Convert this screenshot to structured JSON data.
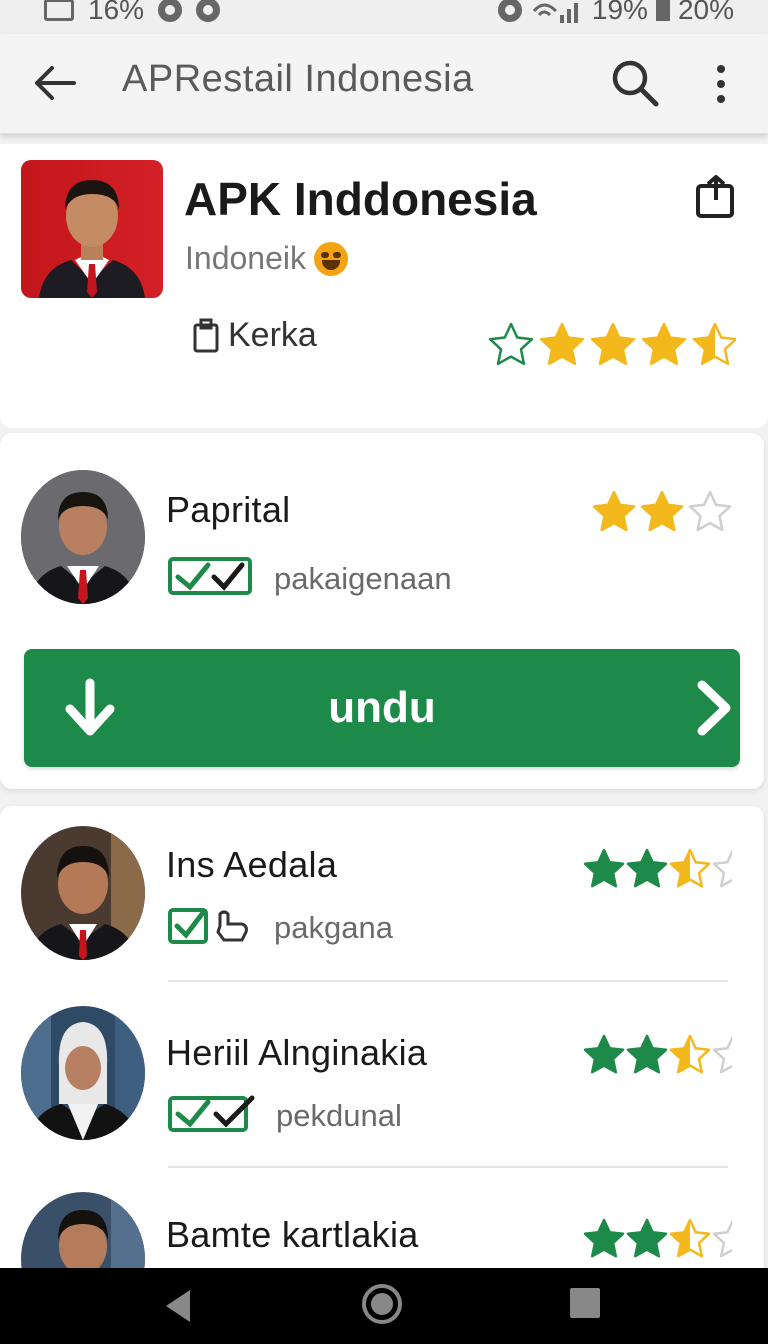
{
  "status_bar": {
    "left_text": "16%",
    "right_signal": "19%",
    "right_battery": "20%"
  },
  "app_bar": {
    "title": "APRestail Indonesia"
  },
  "app_header": {
    "name": "APK Inddonesia",
    "developer": "Indoneik",
    "install_label": "Kerka",
    "rating_stars": 3.5
  },
  "featured": {
    "title": "Paprital",
    "subtitle": "pakaigenaan",
    "rating_stars": 2.0,
    "download_label": "undu"
  },
  "list": [
    {
      "title": "Ins Aedala",
      "subtitle": "pakgana",
      "rating_stars": 2.5,
      "badge": "check-hand"
    },
    {
      "title": "Heriil Alnginakia",
      "subtitle": "pekdunal",
      "rating_stars": 2.5,
      "badge": "double-check"
    },
    {
      "title": "Bamte kartlakia",
      "subtitle": "",
      "rating_stars": 2.5,
      "badge": ""
    }
  ],
  "colors": {
    "accent": "#1e8a4a",
    "star": "#f3b81c",
    "star_green": "#1e8a4a"
  }
}
